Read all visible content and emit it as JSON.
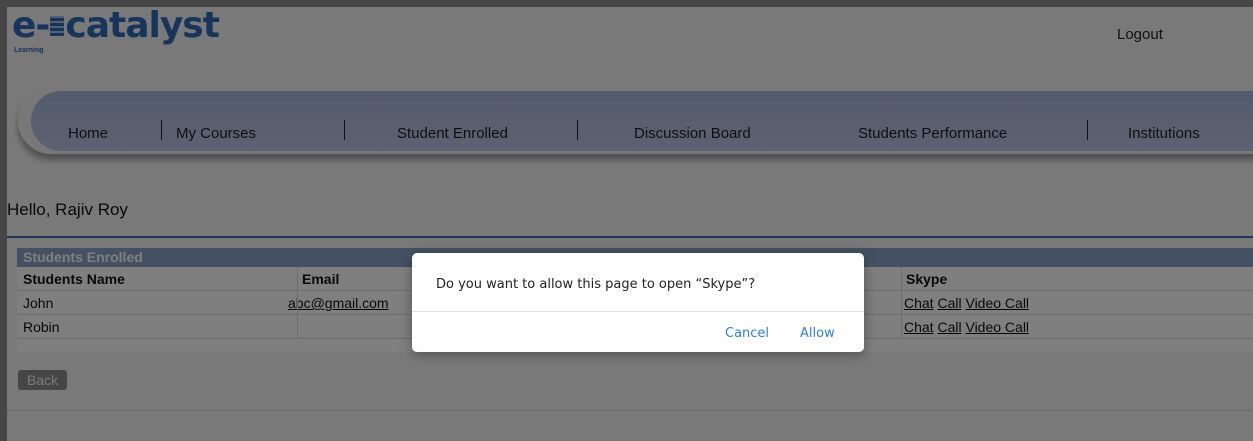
{
  "header": {
    "logo_text": "e-catalyst",
    "logo_prefix": "e-",
    "logo_suffix": "catalyst",
    "logo_sub": "Learning",
    "logout_label": "Logout"
  },
  "nav": {
    "items": [
      "Home",
      "My Courses",
      "Student Enrolled",
      "Discussion Board",
      "Students Performance",
      "Institutions"
    ]
  },
  "greeting": "Hello, Rajiv Roy",
  "table": {
    "caption": "Students Enrolled",
    "columns": [
      "Students Name",
      "Email",
      "",
      "Skype"
    ],
    "rows": [
      {
        "name": "John",
        "email": "abc@gmail.com",
        "skype": [
          "Chat",
          "Call",
          "Video Call"
        ]
      },
      {
        "name": "Robin",
        "email": "",
        "skype": [
          "Chat",
          "Call",
          "Video Call"
        ]
      }
    ]
  },
  "back_label": "Back",
  "dialog": {
    "message": "Do you want to allow this page to open “Skype”?",
    "cancel_label": "Cancel",
    "allow_label": "Allow"
  },
  "colors": {
    "logo": "#2f69b5",
    "nav_bar": "#b1bede",
    "table_caption": "#8aa2c4",
    "dialog_button": "#2f7ee6"
  }
}
